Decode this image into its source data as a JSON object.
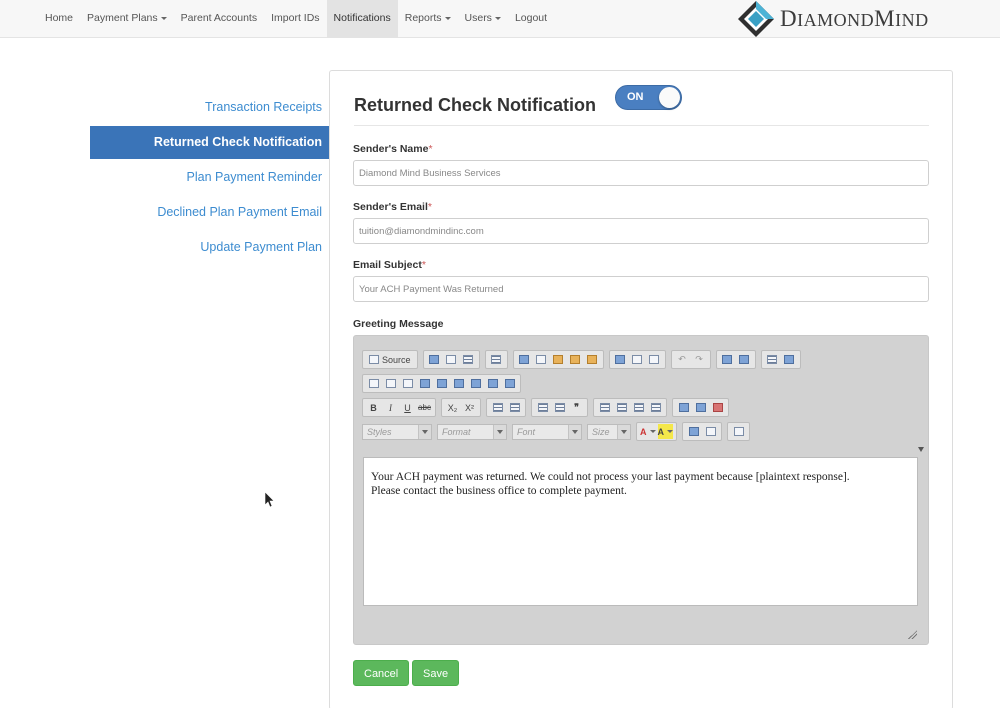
{
  "nav": {
    "items": [
      {
        "label": "Home",
        "dropdown": false,
        "active": false
      },
      {
        "label": "Payment Plans",
        "dropdown": true,
        "active": false
      },
      {
        "label": "Parent Accounts",
        "dropdown": false,
        "active": false
      },
      {
        "label": "Import IDs",
        "dropdown": false,
        "active": false
      },
      {
        "label": "Notifications",
        "dropdown": false,
        "active": true
      },
      {
        "label": "Reports",
        "dropdown": true,
        "active": false
      },
      {
        "label": "Users",
        "dropdown": true,
        "active": false
      },
      {
        "label": "Logout",
        "dropdown": false,
        "active": false
      }
    ],
    "logo_text_big": "D",
    "logo_text_rest1": "IAMOND",
    "logo_text_big2": "M",
    "logo_text_rest2": "IND"
  },
  "sidebar": {
    "items": [
      {
        "label": "Transaction Receipts"
      },
      {
        "label": "Returned Check Notification"
      },
      {
        "label": "Plan Payment Reminder"
      },
      {
        "label": "Declined Plan Payment Email"
      },
      {
        "label": "Update Payment Plan"
      }
    ],
    "active_index": 1
  },
  "panel": {
    "title": "Returned Check Notification",
    "toggle_label": "ON",
    "sender_name_label": "Sender's Name",
    "sender_name_value": "Diamond Mind Business Services",
    "sender_email_label": "Sender's Email",
    "sender_email_value": "tuition@diamondmindinc.com",
    "subject_label": "Email Subject",
    "subject_value": "Your ACH Payment Was Returned",
    "greeting_label": "Greeting Message",
    "required_marker": "*"
  },
  "editor": {
    "source_label": "Source",
    "styles_placeholder": "Styles",
    "format_placeholder": "Format",
    "font_placeholder": "Font",
    "size_placeholder": "Size",
    "bold": "B",
    "italic": "I",
    "underline": "U",
    "subscript": "X₂",
    "superscript": "X²",
    "blockquote": "❞",
    "text_color": "A",
    "bg_color": "A",
    "body_line1": "Your ACH payment was returned. We could not process your last payment because [plaintext response].",
    "body_line2": "Please contact the business office to complete payment."
  },
  "actions": {
    "cancel_label": "Cancel",
    "save_label": "Save"
  }
}
